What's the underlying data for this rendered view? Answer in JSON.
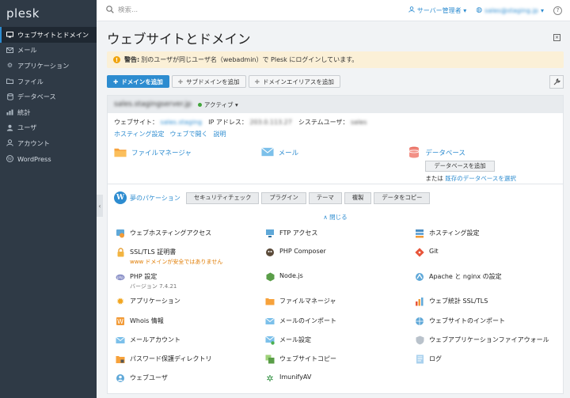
{
  "app": {
    "logo": "plesk"
  },
  "colors": {
    "accent": "#2d8cd0",
    "sidebar": "#2f3a46",
    "warning_bg": "#fbf0d7",
    "active_green": "#42a53c"
  },
  "sidebar": {
    "items": [
      {
        "label": "ウェブサイトとドメイン",
        "icon": "monitor-icon",
        "active": true
      },
      {
        "label": "メール",
        "icon": "mail-icon"
      },
      {
        "label": "アプリケーション",
        "icon": "gear-icon"
      },
      {
        "label": "ファイル",
        "icon": "folder-icon"
      },
      {
        "label": "データベース",
        "icon": "database-icon"
      },
      {
        "label": "統計",
        "icon": "chart-icon"
      },
      {
        "label": "ユーザ",
        "icon": "user-icon"
      },
      {
        "label": "アカウント",
        "icon": "account-icon"
      },
      {
        "label": "WordPress",
        "icon": "wordpress-icon"
      }
    ]
  },
  "topbar": {
    "search_placeholder": "検索...",
    "user": "サーバー管理者",
    "email": "sales@staging.jp"
  },
  "page": {
    "title": "ウェブサイトとドメイン"
  },
  "warning": {
    "label": "警告:",
    "text": "別のユーザが同じユーザ名（webadmin）で Plesk にログインしています。"
  },
  "toolbar": {
    "add_domain": "ドメインを追加",
    "add_subdomain": "サブドメインを追加",
    "add_alias": "ドメインエイリアスを追加"
  },
  "domain": {
    "name": "sales.stagingserver.jp",
    "status": "アクティブ",
    "website_label": "ウェブサイト：",
    "website_value": "sales.staging",
    "ip_label": "IP アドレス：",
    "ip_value": "203.0.113.27",
    "sysuser_label": "システムユーザ：",
    "sysuser_value": "sales",
    "links": [
      "ホスティング設定",
      "ウェブで開く",
      "説明"
    ]
  },
  "quick": {
    "file_manager": "ファイルマネージャ",
    "mail": "メール",
    "database": "データベース",
    "add_database": "データベースを追加",
    "or": "または",
    "select_db": "既存のデータベースを選択"
  },
  "tabs": {
    "wp": "夢のパケーション",
    "items": [
      "セキュリティチェック",
      "プラグイン",
      "テーマ",
      "複製",
      "データをコピー"
    ]
  },
  "toggle": "∧ 閉じる",
  "tools": [
    {
      "label": "ウェブホスティングアクセス",
      "icon": "hosting-access-icon"
    },
    {
      "label": "FTP アクセス",
      "icon": "ftp-icon"
    },
    {
      "label": "ホスティング設定",
      "icon": "hosting-settings-icon"
    },
    {
      "label": "SSL/TLS 証明書",
      "sub": "www ドメインが安全ではありません",
      "icon": "lock-icon"
    },
    {
      "label": "PHP Composer",
      "icon": "composer-icon"
    },
    {
      "label": "Git",
      "icon": "git-icon"
    },
    {
      "label": "PHP 設定",
      "sub": "バージョン 7.4.21",
      "icon": "php-icon"
    },
    {
      "label": "Node.js",
      "icon": "nodejs-icon"
    },
    {
      "label": "Apache と nginx の設定",
      "icon": "apache-icon"
    },
    {
      "label": "アプリケーション",
      "icon": "app-gear-icon"
    },
    {
      "label": "ファイルマネージャ",
      "icon": "folder-icon"
    },
    {
      "label": "ウェブ統計 SSL/TLS",
      "icon": "stats-icon"
    },
    {
      "label": "Whois 情報",
      "icon": "whois-icon"
    },
    {
      "label": "メールのインポート",
      "icon": "mail-import-icon"
    },
    {
      "label": "ウェブサイトのインポート",
      "icon": "site-import-icon"
    },
    {
      "label": "メールアカウント",
      "icon": "mail-account-icon"
    },
    {
      "label": "メール設定",
      "icon": "mail-settings-icon"
    },
    {
      "label": "ウェブアプリケーションファイアウォール",
      "icon": "shield-icon"
    },
    {
      "label": "パスワード保護ディレクトリ",
      "icon": "protected-dir-icon"
    },
    {
      "label": "ウェブサイトコピー",
      "icon": "site-copy-icon"
    },
    {
      "label": "ログ",
      "icon": "log-icon"
    },
    {
      "label": "ウェブユーザ",
      "icon": "web-user-icon"
    },
    {
      "label": "ImunifyAV",
      "icon": "imunify-icon"
    }
  ]
}
